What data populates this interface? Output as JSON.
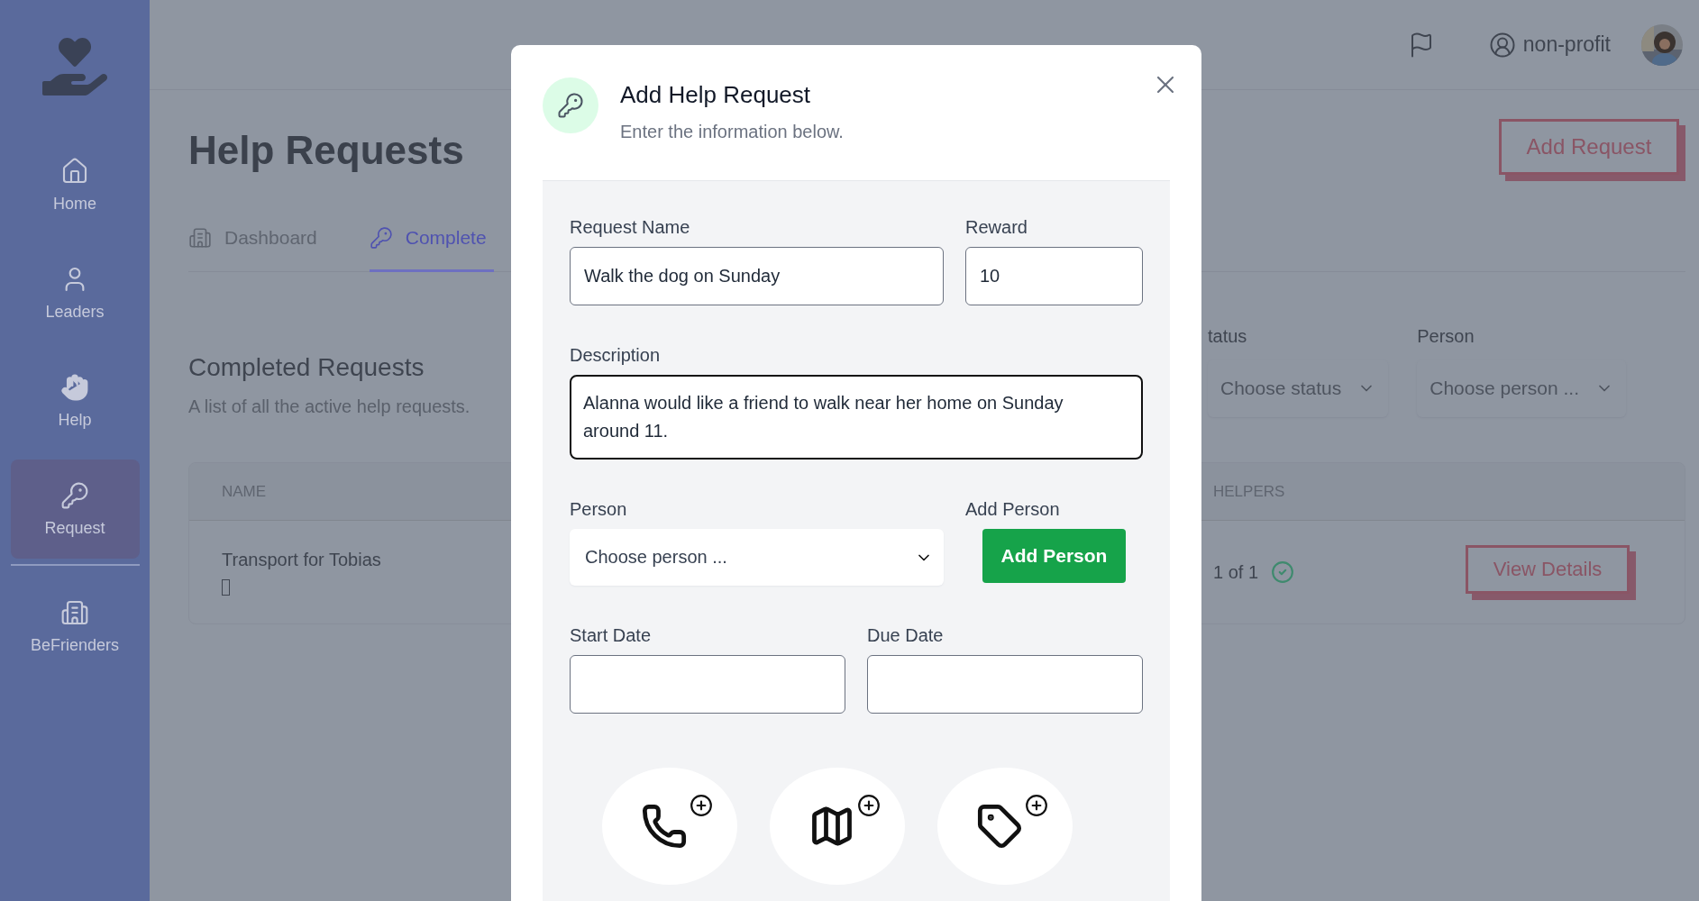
{
  "sidebar": {
    "items": [
      {
        "label": "Home",
        "kind": "home",
        "selected": false
      },
      {
        "label": "Leaders",
        "kind": "user",
        "selected": false
      },
      {
        "label": "Help",
        "kind": "hand",
        "selected": false
      },
      {
        "label": "Request",
        "kind": "key",
        "selected": true
      },
      {
        "label": "BeFrienders",
        "kind": "building",
        "selected": false
      }
    ]
  },
  "top_bar": {
    "account": "non-profit"
  },
  "page": {
    "title": "Help Requests",
    "add_button": "Add Request",
    "tabs": [
      {
        "label": "Dashboard",
        "kind": "building",
        "selected": false
      },
      {
        "label": "Complete",
        "kind": "key",
        "selected": true
      }
    ],
    "section_title": "Completed Requests",
    "section_subtitle": "A list of all the active help requests.",
    "filters": [
      {
        "label": "tatus",
        "placeholder": "Choose status"
      },
      {
        "label": "Person",
        "placeholder": "Choose person ..."
      }
    ],
    "table": {
      "columns": [
        "NAME",
        "HELPERS"
      ],
      "rows": [
        {
          "name": "Transport for Tobias",
          "helpers": "1 of 1",
          "complete": true,
          "action": "View Details"
        }
      ]
    }
  },
  "dialog": {
    "title": "Add Help Request",
    "subtitle": "Enter the information below.",
    "request_name": {
      "label": "Request Name",
      "value": "Walk the dog on Sunday"
    },
    "reward": {
      "label": "Reward",
      "value": "10"
    },
    "description": {
      "label": "Description",
      "value": "Alanna would like a friend to walk near her home on Sunday around 11."
    },
    "person": {
      "label": "Person",
      "placeholder": "Choose person ..."
    },
    "add_person": {
      "label": "Add Person",
      "button": "Add Person"
    },
    "start_date": {
      "label": "Start Date"
    },
    "due_date": {
      "label": "Due Date"
    },
    "actions": [
      {
        "kind": "phone"
      },
      {
        "kind": "map"
      },
      {
        "kind": "tag"
      }
    ]
  }
}
